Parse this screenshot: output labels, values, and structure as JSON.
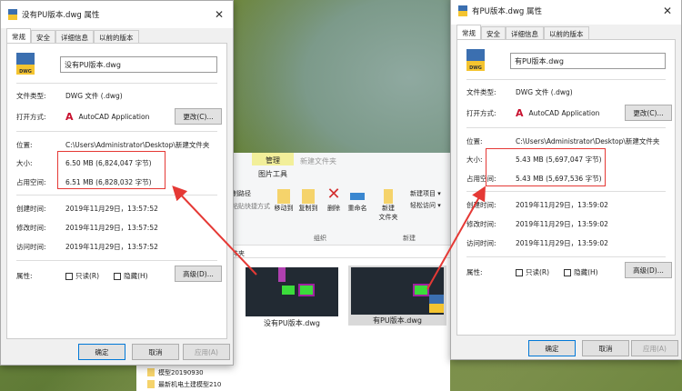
{
  "left_dialog": {
    "title": "没有PU版本.dwg 属性",
    "tabs": [
      "常规",
      "安全",
      "详细信息",
      "以前的版本"
    ],
    "filename": "没有PU版本.dwg",
    "file_type_label": "文件类型:",
    "file_type": "DWG 文件 (.dwg)",
    "open_with_label": "打开方式:",
    "open_with": "AutoCAD Application",
    "change_button": "更改(C)...",
    "location_label": "位置:",
    "location": "C:\\Users\\Administrator\\Desktop\\新建文件夹",
    "size_label": "大小:",
    "size": "6.50 MB (6,824,047 字节)",
    "disk_size_label": "占用空间:",
    "disk_size": "6.51 MB (6,828,032 字节)",
    "created_label": "创建时间:",
    "created": "2019年11月29日，13:57:52",
    "modified_label": "修改时间:",
    "modified": "2019年11月29日，13:57:52",
    "accessed_label": "访问时间:",
    "accessed": "2019年11月29日，13:57:52",
    "attributes_label": "属性:",
    "readonly": "只读(R)",
    "hidden": "隐藏(H)",
    "advanced_button": "高级(D)...",
    "ok": "确定",
    "cancel": "取消",
    "apply": "应用(A)",
    "icon_text": "DWG"
  },
  "right_dialog": {
    "title": "有PU版本.dwg 属性",
    "tabs": [
      "常规",
      "安全",
      "详细信息",
      "以前的版本"
    ],
    "filename": "有PU版本.dwg",
    "file_type_label": "文件类型:",
    "file_type": "DWG 文件 (.dwg)",
    "open_with_label": "打开方式:",
    "open_with": "AutoCAD Application",
    "change_button": "更改(C)...",
    "location_label": "位置:",
    "location": "C:\\Users\\Administrator\\Desktop\\新建文件夹",
    "size_label": "大小:",
    "size": "5.43 MB (5,697,047 字节)",
    "disk_size_label": "占用空间:",
    "disk_size": "5.43 MB (5,697,536 字节)",
    "created_label": "创建时间:",
    "created": "2019年11月29日，13:59:02",
    "modified_label": "修改时间:",
    "modified": "2019年11月29日，13:59:02",
    "accessed_label": "访问时间:",
    "accessed": "2019年11月29日，13:59:02",
    "attributes_label": "属性:",
    "readonly": "只读(R)",
    "hidden": "隐藏(H)",
    "advanced_button": "高级(D)...",
    "ok": "确定",
    "cancel": "取消",
    "apply": "应用(A)",
    "icon_text": "DWG"
  },
  "explorer": {
    "manage_tab": "管理",
    "new_folder_title": "新建文件夹",
    "picture_tools": "图片工具",
    "copy_path": "制路径",
    "paste_shortcut": "粘贴快捷方式",
    "move_to": "移动到",
    "copy_to": "复制到",
    "delete": "删除",
    "rename": "重命名",
    "new_folder": "新建\n文件夹",
    "new_item": "新建项目 ▾",
    "easy_access": "轻松访问 ▾",
    "group_organize": "组织",
    "group_new": "新建",
    "path_fragment": "件夹",
    "files": [
      "没有PU版本.dwg",
      "有PU版本.dwg"
    ],
    "folders": [
      "模型20190930",
      "最新机电土建模型210"
    ]
  }
}
